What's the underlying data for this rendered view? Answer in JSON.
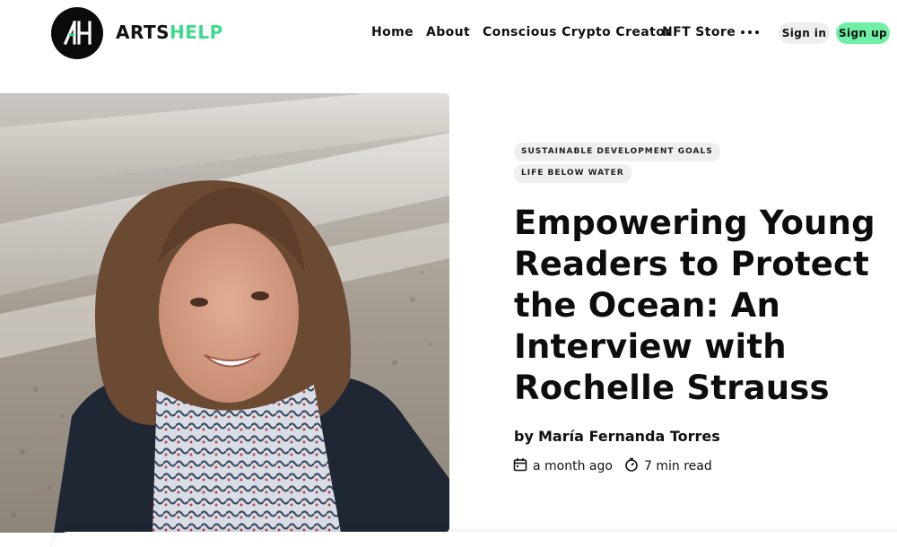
{
  "header": {
    "brand_part1": "ARTS",
    "brand_part2": "HELP",
    "logo_icon": "artshelp-logo-icon",
    "nav": [
      {
        "label": "Home"
      },
      {
        "label": "About"
      },
      {
        "label": "Conscious Crypto Creator"
      },
      {
        "label": "NFT Store"
      }
    ],
    "more_icon": "more-dots-icon",
    "signin_label": "Sign in",
    "signup_label": "Sign up",
    "colors": {
      "brand_green": "#3ddc8a",
      "signup_bg": "#6ff0a6",
      "signin_bg": "#eeeeee"
    }
  },
  "article": {
    "tags": [
      "SUSTAINABLE DEVELOPMENT GOALS",
      "LIFE BELOW WATER"
    ],
    "title_lines": [
      "Empowering Young",
      "Readers to Protect",
      "the Ocean: An",
      "Interview with",
      "Rochelle Strauss"
    ],
    "by": "by",
    "author": "María Fernanda Torres",
    "date": "a month ago",
    "read_time": "7 min read",
    "date_icon": "calendar-icon",
    "read_icon": "timer-icon"
  }
}
